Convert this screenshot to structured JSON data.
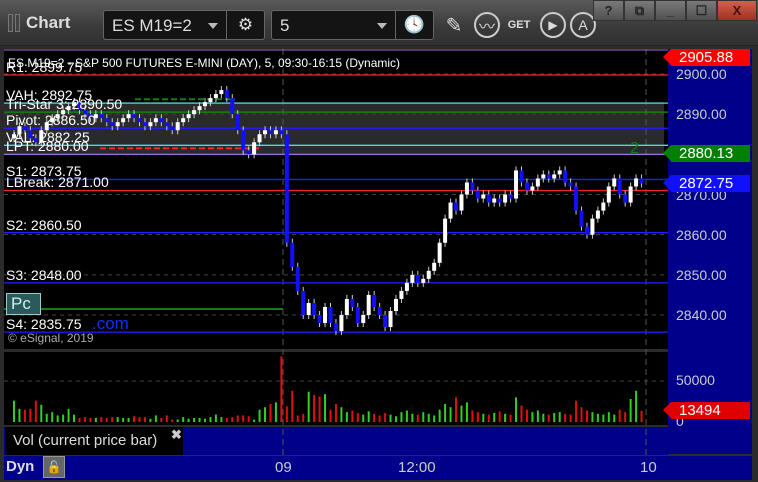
{
  "window": {
    "title": "Chart",
    "symbol": "ES M19=2",
    "interval": "5",
    "help": "?",
    "close": "X"
  },
  "toolbar_icons": [
    "settings-icon",
    "clock-icon",
    "pencil-icon",
    "study-icon",
    "get-icon",
    "play-icon",
    "a-icon"
  ],
  "chart_header": "ES M19=2 - S&P 500 FUTURES E-MINI (DAY), 5, 09:30-16:15 (Dynamic)",
  "levels": [
    {
      "label": "R1: 2899.75",
      "price": 2899.75,
      "color": "#ff2020"
    },
    {
      "label": "VAH: 2892.75",
      "price": 2892.75,
      "color": "#40e0e0"
    },
    {
      "label": "Tri-Star 3: 2890.50",
      "price": 2890.5,
      "color": "#109010"
    },
    {
      "label": "Pivot: 2886.50",
      "price": 2886.5,
      "color": "#2020ff"
    },
    {
      "label": "VAL: 2882.25",
      "price": 2882.25,
      "color": "#40e0e0"
    },
    {
      "label": "LPT: 2880.00",
      "price": 2880.0,
      "color": "#a070e0"
    },
    {
      "label": "S1: 2873.75",
      "price": 2873.75,
      "color": "#2020ff"
    },
    {
      "label": "LBreak: 2871.00",
      "price": 2871.0,
      "color": "#ff2020"
    },
    {
      "label": "S2: 2860.50",
      "price": 2860.5,
      "color": "#2020ff"
    },
    {
      "label": "S3: 2848.00",
      "price": 2848.0,
      "color": "#2020ff"
    },
    {
      "label": "S4: 2835.75",
      "price": 2835.75,
      "color": "#2020ff"
    }
  ],
  "extra": {
    "com": ".com",
    "copyright": "© eSignal, 2019",
    "pc": "Pc",
    "marker": "2"
  },
  "price_axis": {
    "ticks": [
      "2900.00",
      "2890.00",
      "2880.00",
      "2870.00",
      "2860.00",
      "2850.00",
      "2840.00"
    ],
    "tick_values": [
      2900,
      2890,
      2880,
      2870,
      2860,
      2850,
      2840
    ],
    "high_tag": "2905.88",
    "high_color": "#ff0000",
    "low_tag": "2880.13",
    "low_color": "#008000",
    "last_tag": "2872.75",
    "last_color": "#1010ff"
  },
  "volume_axis": {
    "ticks": [
      "50000",
      "0"
    ],
    "last_tag": "13494",
    "last_color": "#e00000"
  },
  "volume_legend": "Vol (current price bar)",
  "time_axis": {
    "mode": "Dyn",
    "labels": [
      "09",
      "12:00",
      "10"
    ]
  },
  "chart_data": {
    "type": "candlestick",
    "ylim": [
      2832,
      2906
    ],
    "close": [
      2885,
      2887,
      2886,
      2884,
      2883,
      2886,
      2888,
      2889,
      2890,
      2891,
      2892,
      2893,
      2891,
      2890,
      2889,
      2890,
      2889,
      2888,
      2887,
      2888,
      2889,
      2890,
      2889,
      2888,
      2887,
      2888,
      2889,
      2888,
      2887,
      2886,
      2888,
      2889,
      2890,
      2891,
      2892,
      2893,
      2894,
      2895,
      2896,
      2894,
      2890,
      2886,
      2881,
      2880,
      2883,
      2885,
      2886,
      2885,
      2886,
      2885,
      2858,
      2852,
      2846,
      2840,
      2843,
      2840,
      2838,
      2842,
      2838,
      2836,
      2840,
      2844,
      2842,
      2838,
      2840,
      2845,
      2842,
      2840,
      2837,
      2841,
      2844,
      2846,
      2848,
      2850,
      2848,
      2849,
      2851,
      2853,
      2858,
      2864,
      2868,
      2866,
      2870,
      2873,
      2871,
      2869,
      2870,
      2868,
      2869,
      2868,
      2870,
      2869,
      2876,
      2873,
      2871,
      2872,
      2874,
      2875,
      2874,
      2875,
      2876,
      2873,
      2872,
      2866,
      2862,
      2860,
      2864,
      2866,
      2868,
      2872,
      2874,
      2870,
      2868,
      2872,
      2874,
      2872.75
    ],
    "volume": [
      26000,
      16000,
      15000,
      16000,
      26000,
      21000,
      10000,
      12000,
      8000,
      9000,
      16000,
      9000,
      5000,
      6000,
      5000,
      5000,
      6000,
      5000,
      6000,
      6000,
      5000,
      5000,
      7000,
      6000,
      6000,
      4000,
      8000,
      5000,
      8000,
      3000,
      3000,
      6000,
      4000,
      5000,
      5000,
      4000,
      6000,
      9000,
      6000,
      5000,
      6000,
      8000,
      8000,
      7000,
      3000,
      15000,
      18000,
      22000,
      24000,
      80000,
      19000,
      38000,
      8000,
      10000,
      37000,
      33000,
      31000,
      34000,
      15000,
      22000,
      18000,
      12000,
      14000,
      11000,
      9000,
      13000,
      10000,
      8000,
      11000,
      9000,
      7000,
      12000,
      14000,
      10000,
      9000,
      12000,
      10000,
      8000,
      15000,
      22000,
      18000,
      30000,
      20000,
      24000,
      14000,
      12000,
      10000,
      9000,
      11000,
      13000,
      10000,
      9000,
      30000,
      20000,
      15000,
      12000,
      14000,
      10000,
      9000,
      11000,
      12000,
      10000,
      9000,
      26000,
      18000,
      14000,
      12000,
      10000,
      9000,
      12000,
      9000,
      15000,
      12000,
      28000,
      38000,
      13494
    ]
  }
}
